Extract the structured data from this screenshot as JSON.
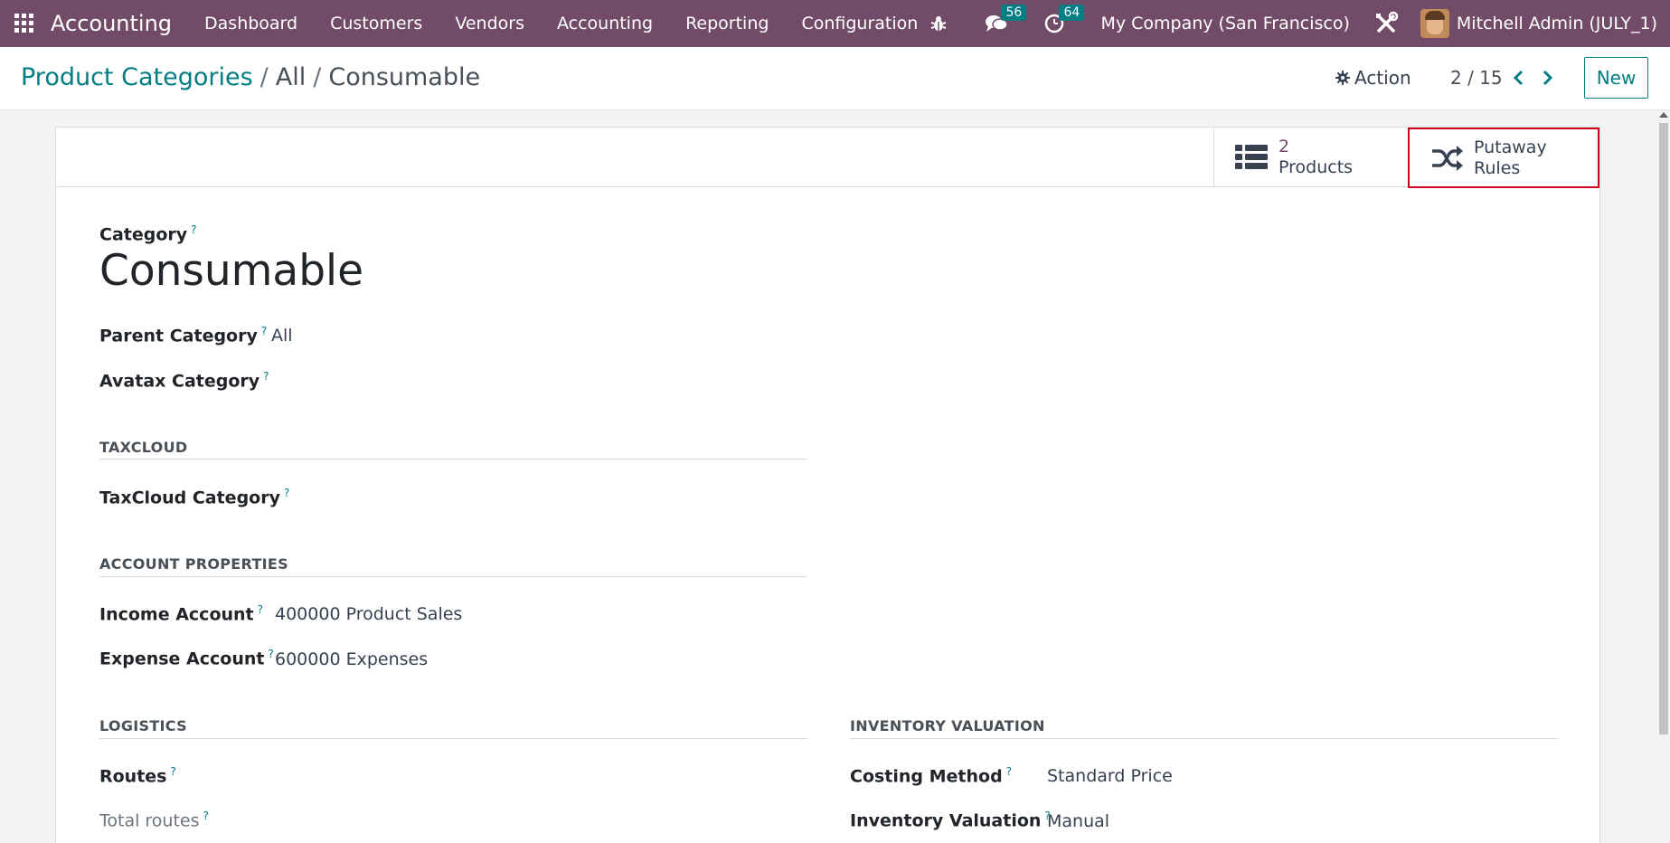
{
  "navbar": {
    "brand": "Accounting",
    "menu": [
      "Dashboard",
      "Customers",
      "Vendors",
      "Accounting",
      "Reporting",
      "Configuration"
    ],
    "messages_count": "56",
    "activities_count": "64",
    "company": "My Company (San Francisco)",
    "user": "Mitchell Admin (JULY_1)"
  },
  "control": {
    "breadcrumb": [
      "Product Categories",
      "All",
      "Consumable"
    ],
    "separator": "/",
    "action_label": "Action",
    "pager": "2 / 15",
    "new_label": "New"
  },
  "buttons": {
    "products_value": "2",
    "products_label": "Products",
    "putaway_line1": "Putaway",
    "putaway_line2": "Rules"
  },
  "form": {
    "category_label": "Category",
    "name": "Consumable",
    "parent_label": "Parent Category",
    "parent_value": "All",
    "avatax_label": "Avatax Category",
    "taxcloud_section": "TAXCLOUD",
    "taxcloud_label": "TaxCloud Category",
    "account_section": "ACCOUNT PROPERTIES",
    "income_label": "Income Account",
    "income_value": "400000 Product Sales",
    "expense_label": "Expense Account",
    "expense_value": "600000 Expenses",
    "logistics_section": "LOGISTICS",
    "routes_label": "Routes",
    "total_routes_label": "Total routes",
    "valuation_section": "INVENTORY VALUATION",
    "costing_label": "Costing Method",
    "costing_value": "Standard Price",
    "inv_valuation_label": "Inventory Valuation",
    "inv_valuation_value": "Manual",
    "help_mark": "?"
  },
  "colors": {
    "navbar": "#714b67",
    "accent": "#017e84",
    "highlight_border": "#d0021b"
  }
}
